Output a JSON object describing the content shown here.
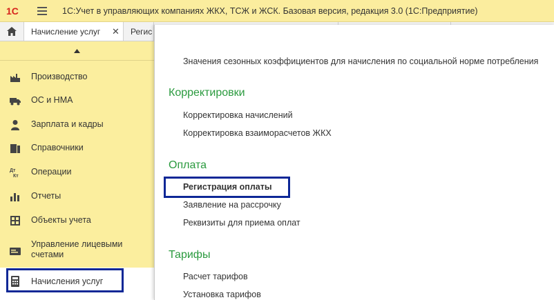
{
  "app": {
    "logo_text": "1С",
    "title": "1С:Учет в управляющих компаниях ЖКХ, ТСЖ и ЖСК. Базовая версия, редакция 3.0  (1С:Предприятие)"
  },
  "tabs": [
    {
      "label": "Начисление услуг"
    },
    {
      "label": "Регис"
    }
  ],
  "sidebar": {
    "items": [
      {
        "label": "Производство"
      },
      {
        "label": "ОС и НМА"
      },
      {
        "label": "Зарплата и кадры"
      },
      {
        "label": "Справочники"
      },
      {
        "label": "Операции"
      },
      {
        "label": "Отчеты"
      },
      {
        "label": "Объекты учета"
      },
      {
        "label": "Управление лицевыми счетами"
      },
      {
        "label": "Начисления услуг"
      }
    ]
  },
  "menu": {
    "top_link": "Значения сезонных коэффициентов для начисления по социальной норме потребления",
    "sections": [
      {
        "title": "Корректировки",
        "links": [
          "Корректировка начислений",
          "Корректировка взаиморасчетов ЖКХ"
        ]
      },
      {
        "title": "Оплата",
        "links": [
          "Регистрация оплаты",
          "Заявление на рассрочку",
          "Реквизиты для приема оплат"
        ]
      },
      {
        "title": "Тарифы",
        "links": [
          "Расчет тарифов",
          "Установка тарифов"
        ]
      }
    ]
  },
  "colors": {
    "header_bg": "#fbed9e",
    "sidebar_bg": "#fbee9e",
    "section_title": "#2a9a3e",
    "highlight_frame": "#0d2796",
    "logo_red": "#d6231c"
  }
}
